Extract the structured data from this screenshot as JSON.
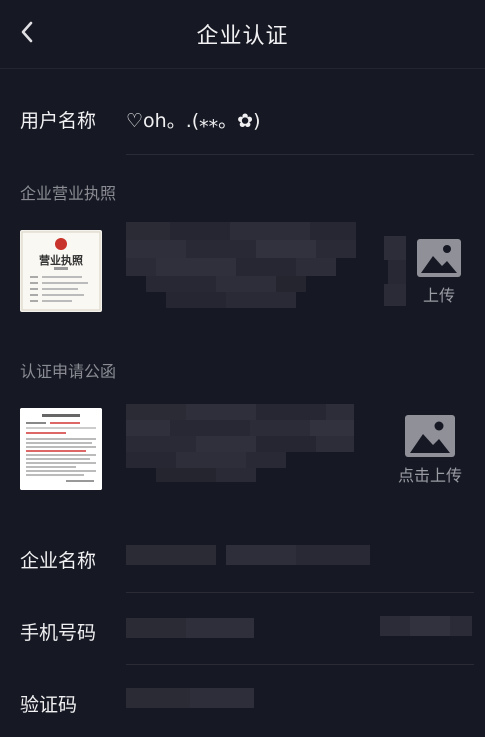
{
  "header": {
    "title": "企业认证",
    "back_icon": "chevron-left-icon"
  },
  "username": {
    "label": "用户名称",
    "value": "♡oh。.(⁎⁎。✿)"
  },
  "license": {
    "section_label": "企业营业执照",
    "upload_label": "上传",
    "thumb_title": "营业执照"
  },
  "letter": {
    "section_label": "认证申请公函",
    "upload_label": "点击上传"
  },
  "form": {
    "company_name_label": "企业名称",
    "phone_label": "手机号码",
    "code_label": "验证码"
  },
  "colors": {
    "background": "#161823",
    "muted_text": "#8a8b93",
    "seal_red": "#c8332b"
  }
}
